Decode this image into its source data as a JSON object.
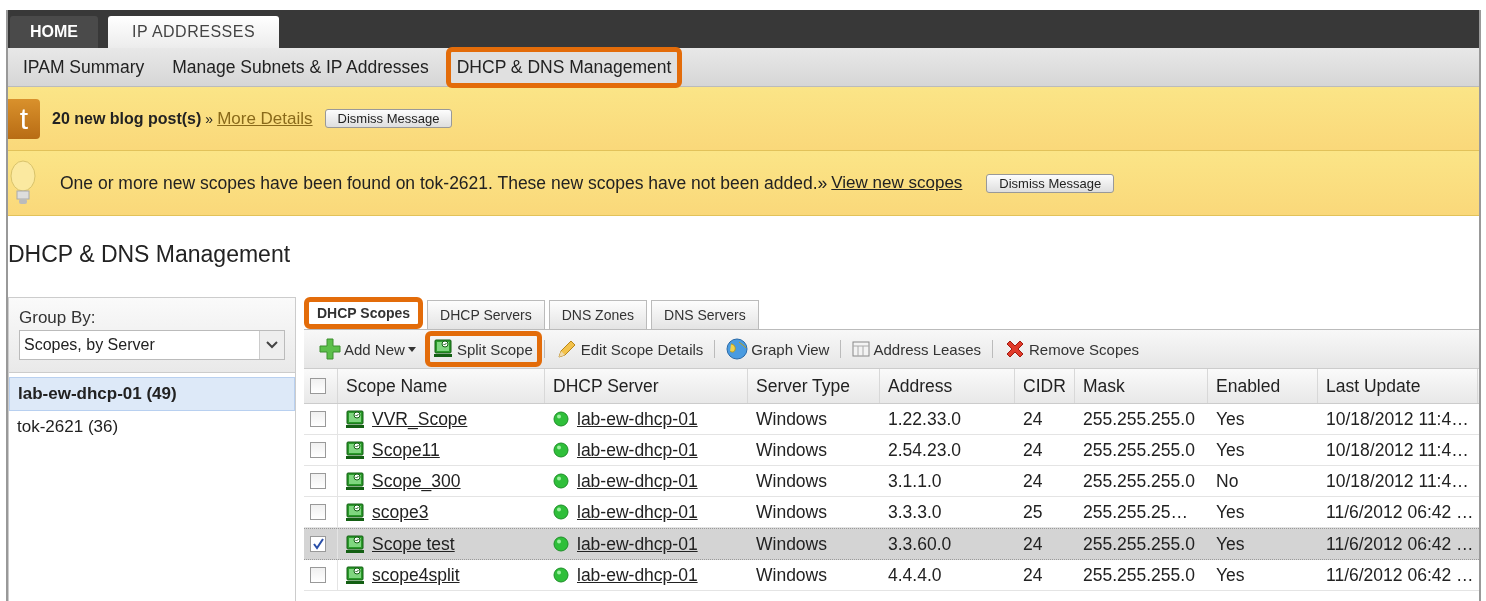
{
  "top_tabs": [
    {
      "label": "HOME",
      "selected": false
    },
    {
      "label": "IP ADDRESSES",
      "selected": true
    }
  ],
  "sub_nav": [
    {
      "label": "IPAM Summary",
      "highlighted": false
    },
    {
      "label": "Manage Subnets & IP Addresses",
      "highlighted": false
    },
    {
      "label": "DHCP & DNS Management",
      "highlighted": true
    }
  ],
  "blog_message": {
    "icon_letter": "t",
    "text": "20 new blog post(s)",
    "separator": "»",
    "link": "More Details",
    "button": "Dismiss Message"
  },
  "scope_message": {
    "text": "One or more new scopes have been found on tok-2621. These new scopes have not been added.»",
    "link": "View new scopes",
    "button": "Dismiss Message"
  },
  "page_title": "DHCP & DNS Management",
  "group_by": {
    "label": "Group By:",
    "value": "Scopes, by Server",
    "items": [
      {
        "label": "lab-ew-dhcp-01 (49)",
        "selected": true
      },
      {
        "label": "tok-2621 (36)",
        "selected": false
      }
    ]
  },
  "tabs": [
    {
      "label": "DHCP Scopes",
      "selected": true,
      "highlighted": true
    },
    {
      "label": "DHCP Servers",
      "selected": false,
      "highlighted": false
    },
    {
      "label": "DNS Zones",
      "selected": false,
      "highlighted": false
    },
    {
      "label": "DNS Servers",
      "selected": false,
      "highlighted": false
    }
  ],
  "toolbar": [
    {
      "kind": "add",
      "label": "Add New",
      "highlighted": false
    },
    {
      "kind": "split",
      "label": "Split Scope",
      "highlighted": true
    },
    {
      "kind": "edit",
      "label": "Edit Scope Details",
      "highlighted": false
    },
    {
      "kind": "graph",
      "label": "Graph View",
      "highlighted": false
    },
    {
      "kind": "leases",
      "label": "Address Leases",
      "highlighted": false
    },
    {
      "kind": "remove",
      "label": "Remove Scopes",
      "highlighted": false
    }
  ],
  "table": {
    "all_checked": false,
    "columns": [
      "Scope Name",
      "DHCP Server",
      "Server Type",
      "Address",
      "CIDR",
      "Mask",
      "Enabled",
      "Last Update"
    ],
    "rows": [
      {
        "checked": false,
        "selected": false,
        "cells": [
          "VVR_Scope",
          "lab-ew-dhcp-01",
          "Windows",
          "1.22.33.0",
          "24",
          "255.255.255.0",
          "Yes",
          "10/18/2012 11:4…"
        ]
      },
      {
        "checked": false,
        "selected": false,
        "cells": [
          "Scope11",
          "lab-ew-dhcp-01",
          "Windows",
          "2.54.23.0",
          "24",
          "255.255.255.0",
          "Yes",
          "10/18/2012 11:4…"
        ]
      },
      {
        "checked": false,
        "selected": false,
        "cells": [
          "Scope_300",
          "lab-ew-dhcp-01",
          "Windows",
          "3.1.1.0",
          "24",
          "255.255.255.0",
          "No",
          "10/18/2012 11:4…"
        ]
      },
      {
        "checked": false,
        "selected": false,
        "cells": [
          "scope3",
          "lab-ew-dhcp-01",
          "Windows",
          "3.3.3.0",
          "25",
          "255.255.25…",
          "Yes",
          "11/6/2012 06:42 …"
        ]
      },
      {
        "checked": true,
        "selected": true,
        "cells": [
          "Scope test",
          "lab-ew-dhcp-01",
          "Windows",
          "3.3.60.0",
          "24",
          "255.255.255.0",
          "Yes",
          "11/6/2012 06:42 …"
        ]
      },
      {
        "checked": false,
        "selected": false,
        "cells": [
          "scope4split",
          "lab-ew-dhcp-01",
          "Windows",
          "4.4.4.0",
          "24",
          "255.255.255.0",
          "Yes",
          "11/6/2012 06:42 …"
        ]
      }
    ]
  }
}
